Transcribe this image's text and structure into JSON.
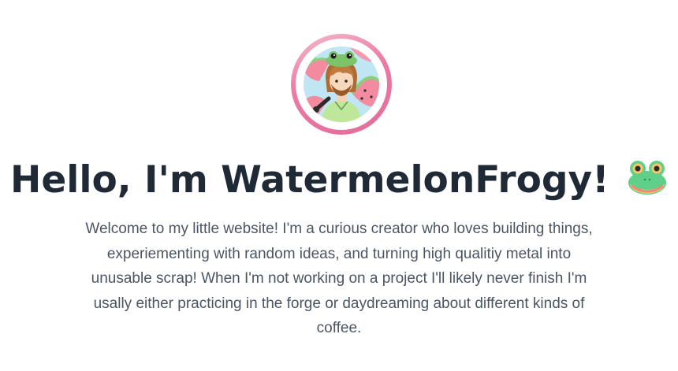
{
  "profile": {
    "avatar_icon": "watermelon-frog-avatar",
    "ring_colors": [
      "#f4b9cb",
      "#e26c9b"
    ]
  },
  "hero": {
    "headline": "Hello, I'm WatermelonFrogy!",
    "headline_emoji": "frog-icon",
    "intro": "Welcome to my little website! I'm a curious creator who loves building things, experiementing with random ideas, and turning high qualitiy metal into unusable scrap! When I'm not working on a project I'll likely never finish I'm usally either practicing in the forge or daydreaming about different kinds of coffee."
  },
  "colors": {
    "heading": "#1f2a36",
    "body_text": "#4b5563",
    "background": "#ffffff"
  }
}
